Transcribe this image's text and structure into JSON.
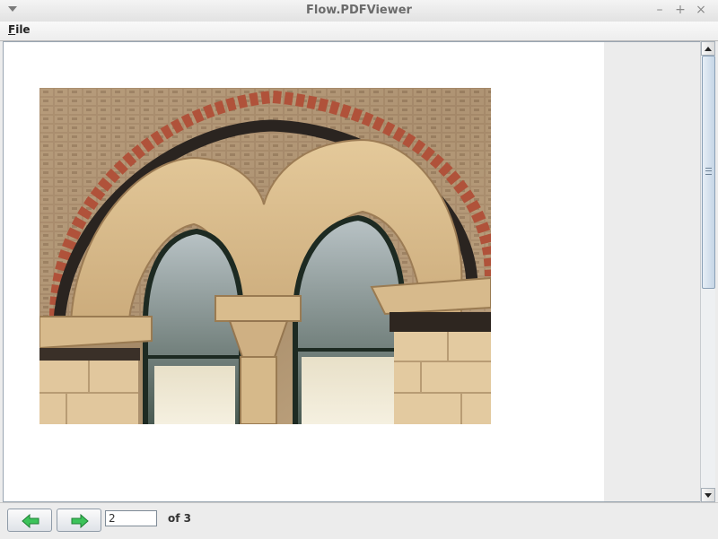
{
  "window": {
    "title": "Flow.PDFViewer",
    "menu_icon": "window-menu-icon",
    "controls": {
      "minimize": "–",
      "maximize": "+",
      "close": "×"
    }
  },
  "menubar": {
    "file_label_first": "F",
    "file_label_rest": "ile"
  },
  "viewer": {
    "page_image": "arched-gothic-windows-photo"
  },
  "navigation": {
    "prev_icon": "arrow-left-icon",
    "next_icon": "arrow-right-icon",
    "current_page": "2",
    "of_label": "of 3",
    "arrow_color": "#2fb84a"
  }
}
